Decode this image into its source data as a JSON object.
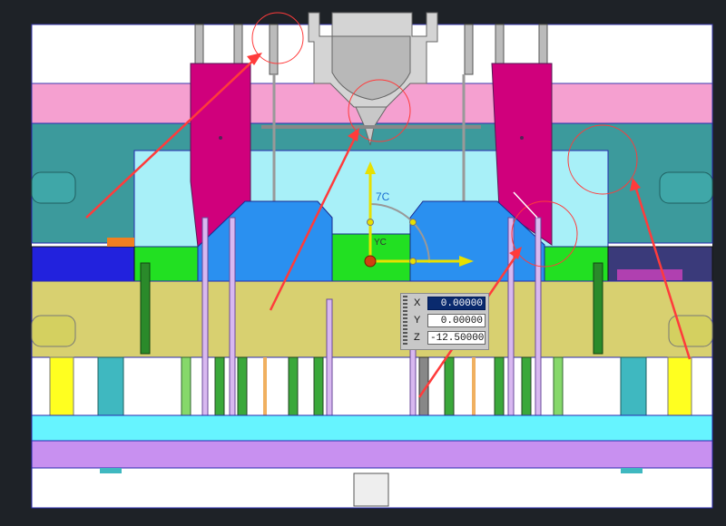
{
  "colors": {
    "frame": "#1e2227",
    "background": "#ffffff",
    "pink_plate": "#f5a0d0",
    "teal_plate": "#3c9a9c",
    "cyan_plate": "#a8f0f8",
    "blue_core": "#2a90f0",
    "green_block": "#22e022",
    "khaki_plate": "#d8d070",
    "magenta_slider": "#d0007c",
    "violet_plate": "#c890f0",
    "ejector_cyan": "#66f4ff",
    "yellow_pin": "#ffff20",
    "annotation_red": "#ff3b3b",
    "outline": "#2a2ab0"
  },
  "dimension": {
    "label": "7C"
  },
  "axis_label": {
    "text": "YC"
  },
  "coordinate_input": {
    "fields": [
      {
        "label": "X",
        "value": "0.00000",
        "active": true
      },
      {
        "label": "Y",
        "value": "0.00000",
        "active": false
      },
      {
        "label": "Z",
        "value": "-12.50000",
        "active": false
      }
    ]
  },
  "icons": [
    "coordinate-panel-grip-icon",
    "move-handle-icon",
    "x-axis-arrow-icon",
    "y-axis-arrow-icon",
    "origin-point-icon"
  ]
}
